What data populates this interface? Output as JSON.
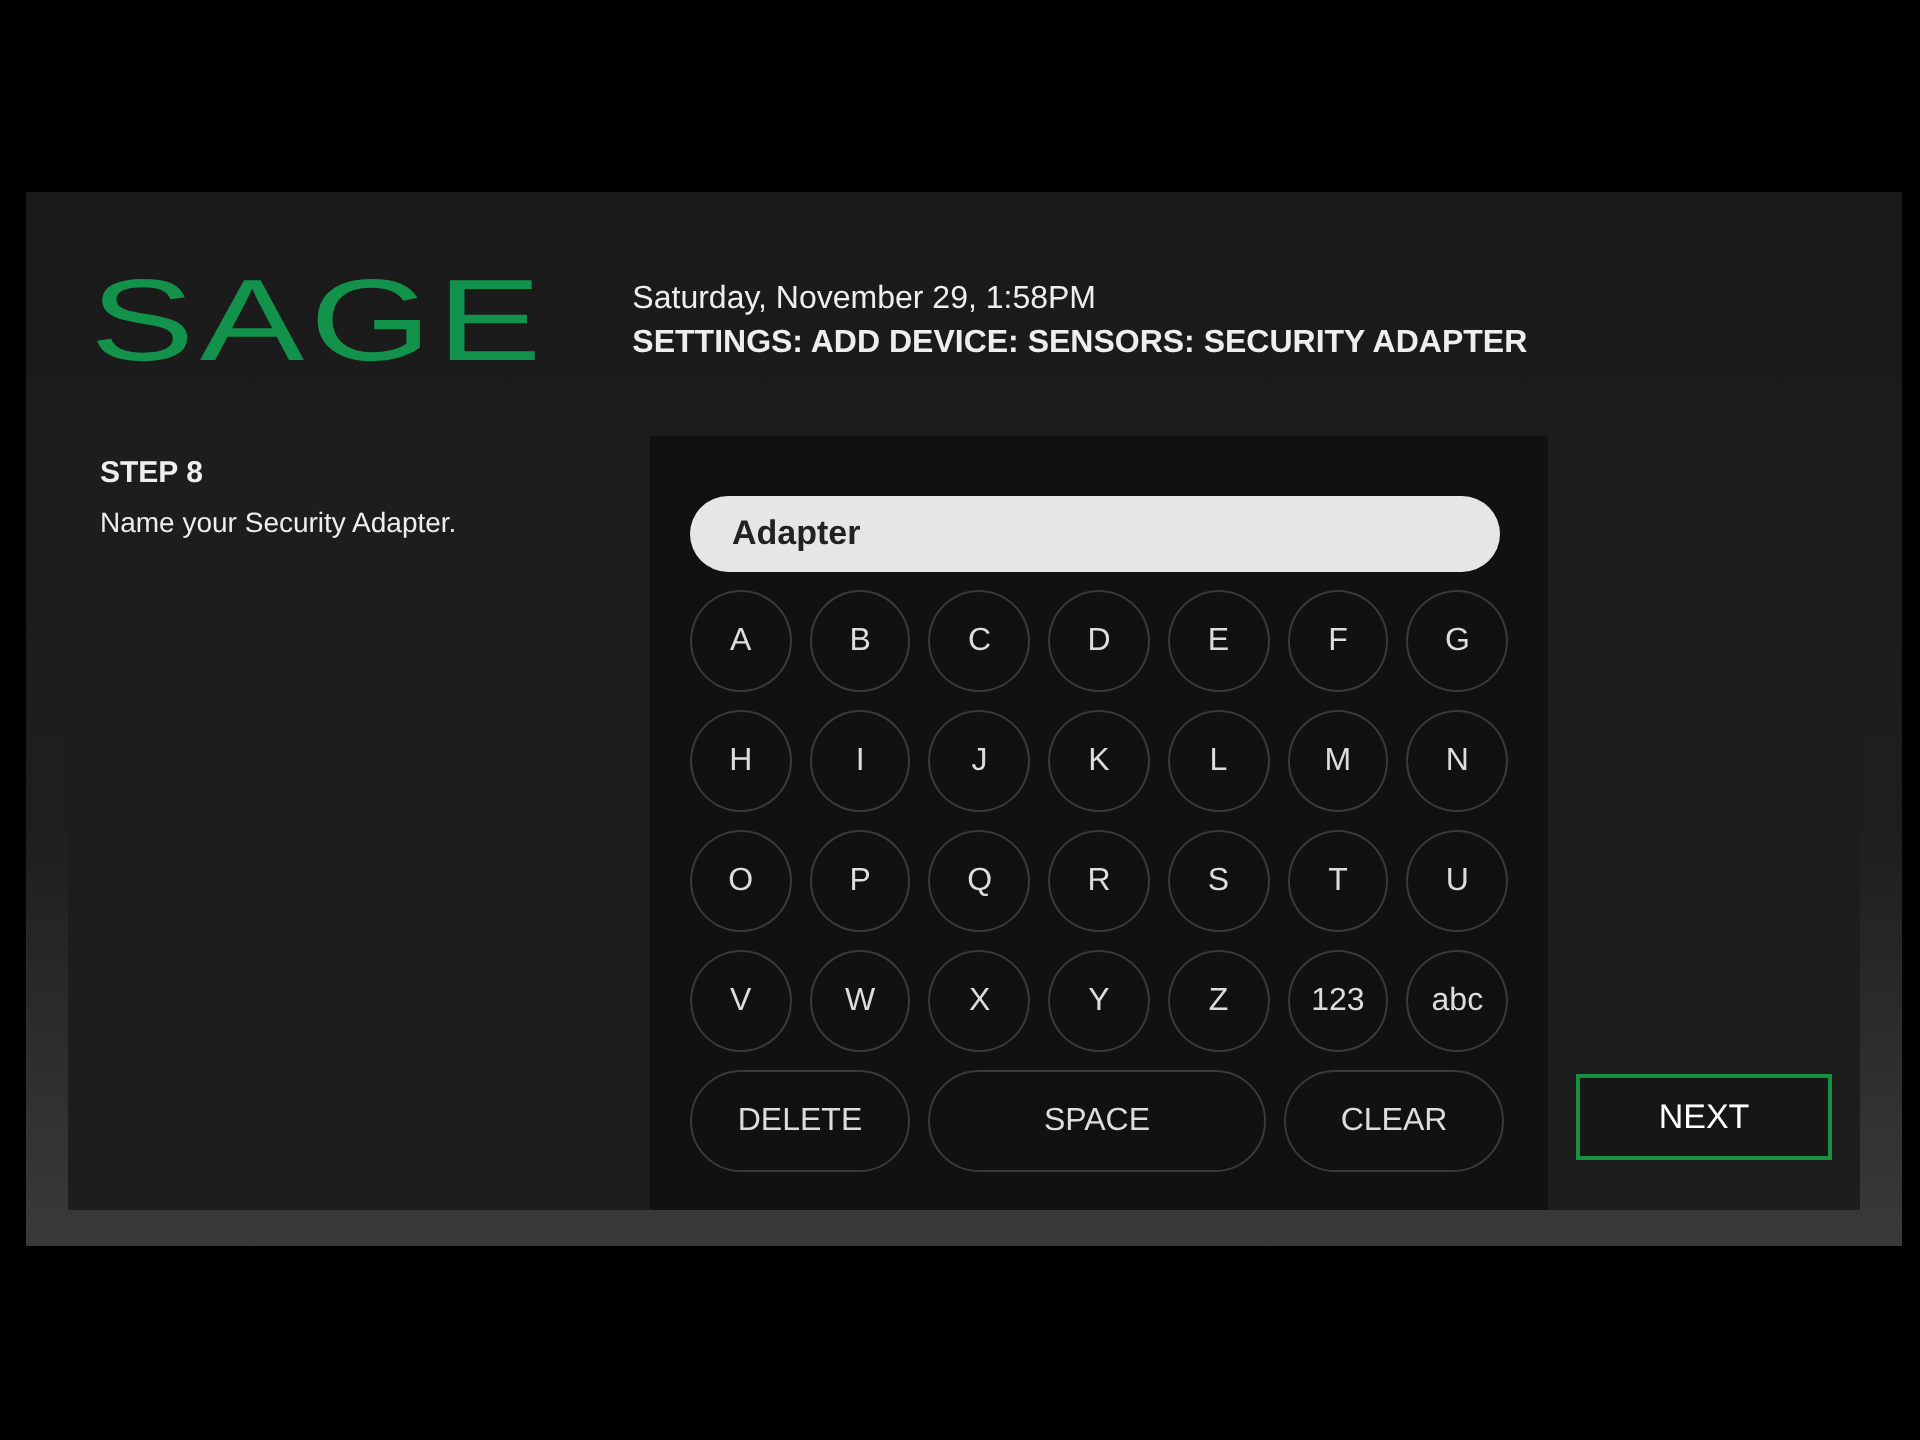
{
  "header": {
    "logo": "SAGE",
    "datetime": "Saturday, November 29, 1:58PM",
    "breadcrumb": "SETTINGS: ADD DEVICE: SENSORS: SECURITY ADAPTER"
  },
  "step": {
    "title": "STEP 8",
    "instruction": "Name your Security Adapter."
  },
  "name_field": {
    "value": "Adapter"
  },
  "keyboard": {
    "rows": [
      [
        "A",
        "B",
        "C",
        "D",
        "E",
        "F",
        "G"
      ],
      [
        "H",
        "I",
        "J",
        "K",
        "L",
        "M",
        "N"
      ],
      [
        "O",
        "P",
        "Q",
        "R",
        "S",
        "T",
        "U"
      ],
      [
        "V",
        "W",
        "X",
        "Y",
        "Z",
        "123",
        "abc"
      ]
    ],
    "actions": [
      {
        "label": "DELETE",
        "kind": "narrow"
      },
      {
        "label": "SPACE",
        "kind": "wide"
      },
      {
        "label": "CLEAR",
        "kind": "narrow"
      }
    ]
  },
  "next_button": {
    "label": "NEXT"
  }
}
